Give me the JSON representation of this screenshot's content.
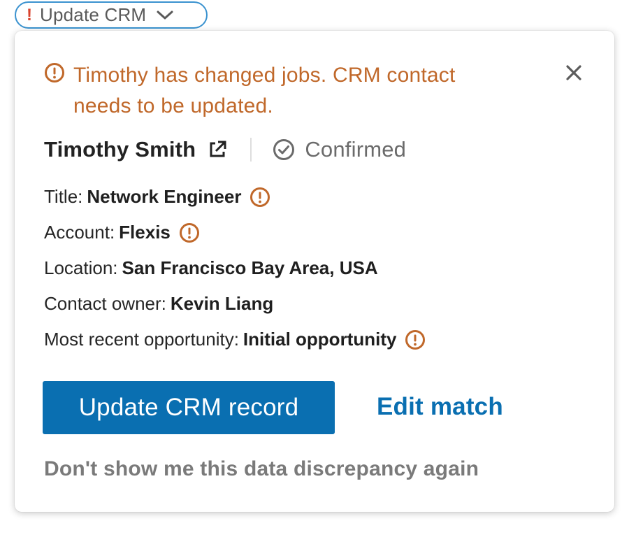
{
  "trigger": {
    "indicator": "!",
    "label": "Update CRM",
    "icon": "chevron-down-icon"
  },
  "colors": {
    "warning": "#c0682a",
    "accent": "#0a6fb1",
    "alert_indicator": "#d9432e",
    "pill_border": "#3a92cf"
  },
  "alert": {
    "icon": "alert-circle-icon",
    "line1": "Timothy has changed jobs. CRM contact",
    "line2": "needs to be updated."
  },
  "close": {
    "icon": "close-icon"
  },
  "contact": {
    "name": "Timothy Smith",
    "external_icon": "external-link-icon",
    "status_icon": "check-circle-icon",
    "status": "Confirmed"
  },
  "fields": {
    "title": {
      "label": "Title:",
      "value": "Network Engineer",
      "warning": true
    },
    "account": {
      "label": "Account:",
      "value": "Flexis",
      "warning": true
    },
    "location": {
      "label": "Location:",
      "value": "San Francisco Bay Area, USA",
      "warning": false
    },
    "owner": {
      "label": "Contact owner:",
      "value": "Kevin Liang",
      "warning": false
    },
    "opportunity": {
      "label": "Most recent opportunity:",
      "value": "Initial opportunity",
      "warning": true
    }
  },
  "actions": {
    "primary": "Update CRM record",
    "secondary": "Edit match",
    "dismiss": "Don't show me this data discrepancy again"
  }
}
